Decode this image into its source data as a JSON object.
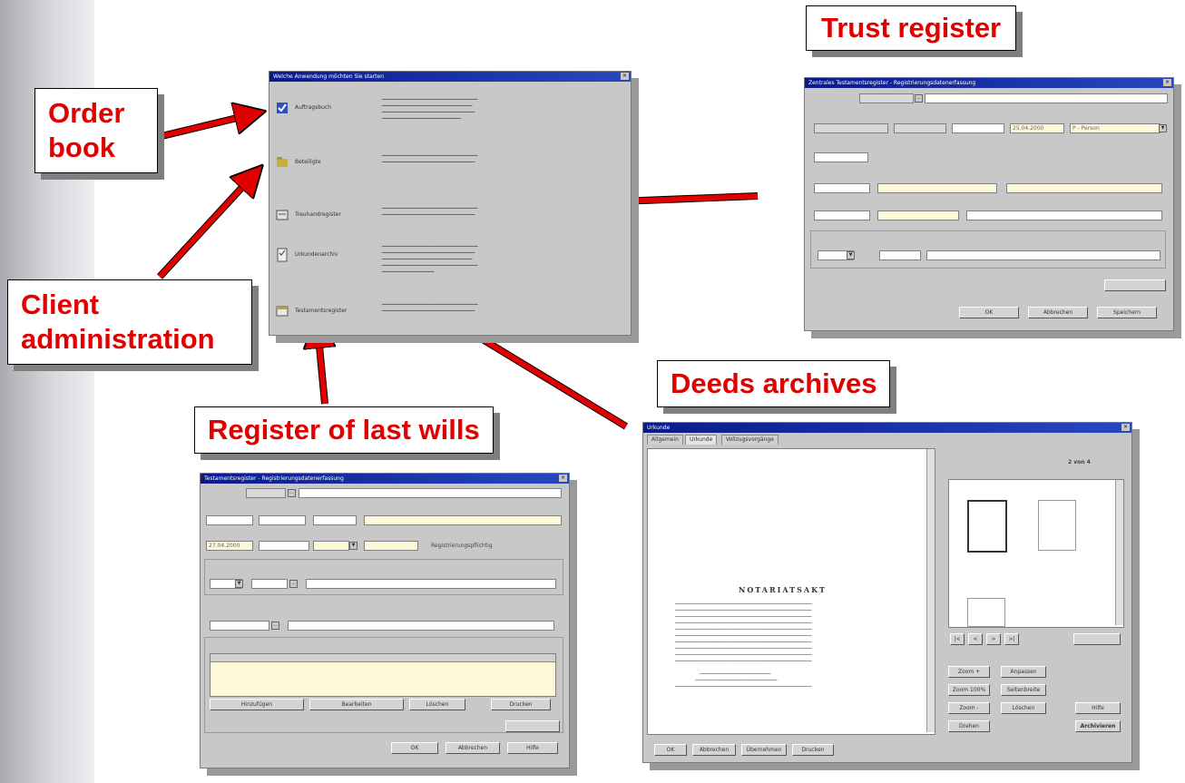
{
  "callouts": {
    "order_book": "Order\nbook",
    "trust_register": "Trust register",
    "client_administration": "Client\nadministration",
    "register_last_wills": "Register of last wills",
    "deeds_archives": "Deeds archives"
  },
  "colors": {
    "callout_text": "#e00000",
    "arrow": "#e00000",
    "titlebar": "#0a1a8c",
    "window_bg": "#c8c8c8"
  },
  "main_window": {
    "title": "Welche Anwendung möchten Sie starten",
    "items": [
      {
        "icon": "order-book-icon",
        "label": "Auftragsbuch"
      },
      {
        "icon": "folder-icon",
        "label": "Beteiligte"
      },
      {
        "icon": "register-icon",
        "label": "Treuhandregister"
      },
      {
        "icon": "deed-icon",
        "label": "Urkundenarchiv"
      },
      {
        "icon": "will-icon",
        "label": "Testamentsregister"
      }
    ]
  },
  "trust_window": {
    "title": "Zentrales Testamentsregister - Registrierungsdatenerfassung",
    "date_value": "25.04.2000",
    "select_value": "P - Person",
    "buttons": [
      "OK",
      "Abbrechen",
      "Speichern"
    ]
  },
  "wills_window": {
    "title": "Testamentsregister - Registrierungsdatenerfassung",
    "date_value": "27.04.2000",
    "checkbox_label": "Registrierungspflichtig",
    "buttons": [
      "Hinzufügen",
      "Bearbeiten",
      "Löschen",
      "Drucken",
      "OK",
      "Abbrechen",
      "Hilfe"
    ]
  },
  "deeds_window": {
    "title": "Urkunde",
    "tabs": [
      "Allgemein",
      "Urkunde",
      "Vollzugsvorgänge"
    ],
    "page_info": "2 von 4",
    "document_heading": "NOTARIATSAKT",
    "side_buttons": [
      "Zoom +",
      "Zoom 100%",
      "Zoom -",
      "Drehen",
      "Anpassen",
      "Seitenbreite",
      "Löschen",
      "Hilfe",
      "Archivieren"
    ],
    "bottom_buttons": [
      "OK",
      "Abbrechen",
      "Übernehmen",
      "Drucken"
    ]
  }
}
